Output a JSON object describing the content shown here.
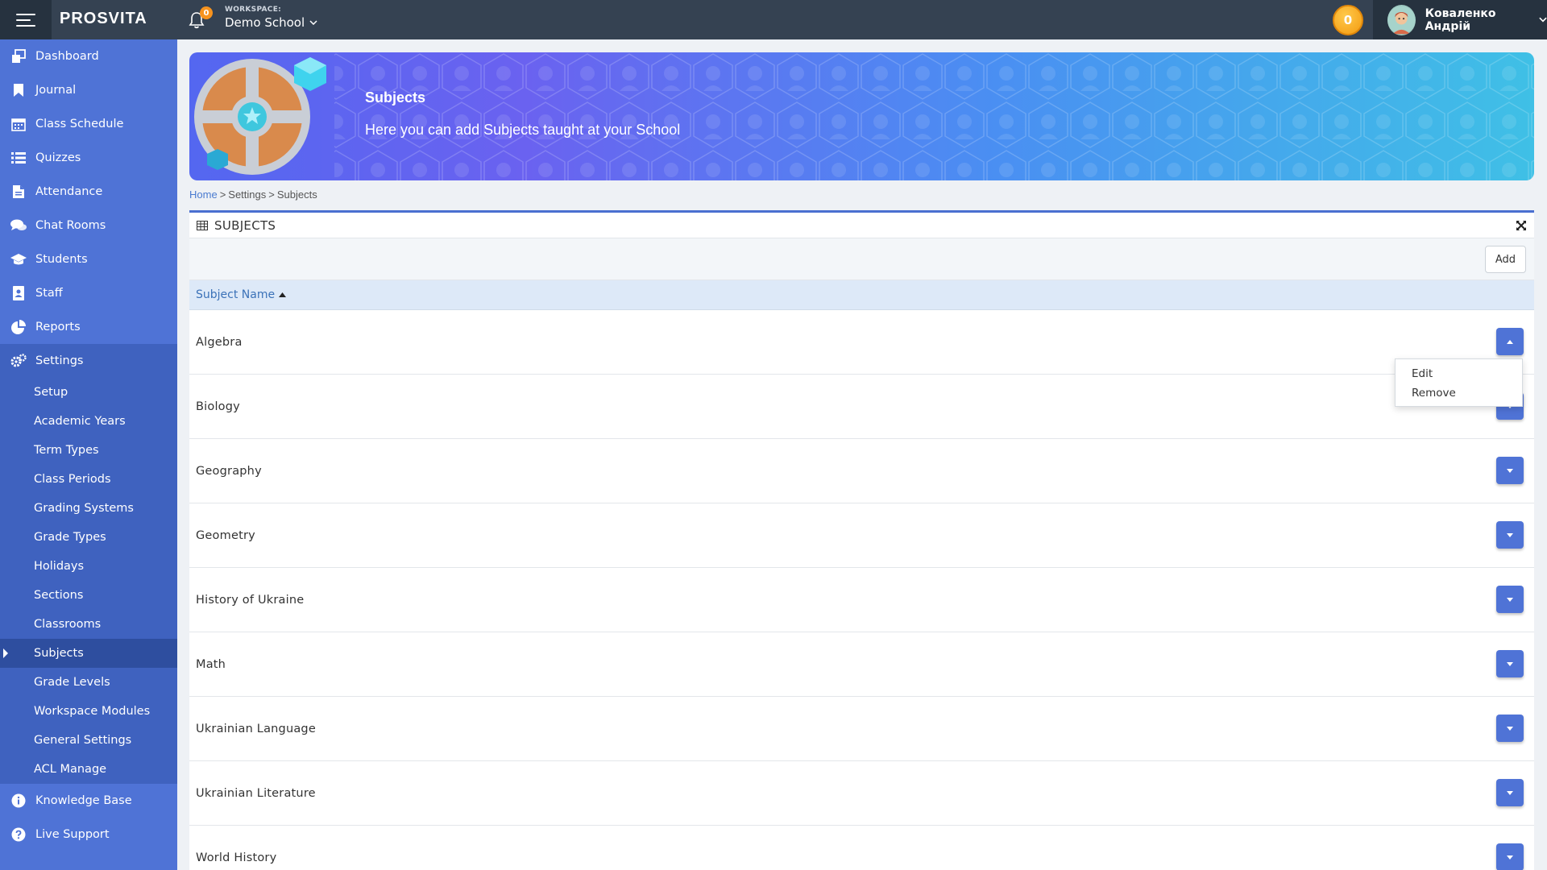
{
  "header": {
    "brand": "PROSVITA",
    "notifications_count": "0",
    "workspace_label": "WORKSPACE:",
    "workspace_name": "Demo School",
    "coins": "0",
    "user_name": "Коваленко Андрій"
  },
  "sidebar": {
    "items": [
      {
        "label": "Dashboard",
        "icon": "dashboard-icon"
      },
      {
        "label": "Journal",
        "icon": "bookmark-icon"
      },
      {
        "label": "Class Schedule",
        "icon": "calendar-icon"
      },
      {
        "label": "Quizzes",
        "icon": "list-icon"
      },
      {
        "label": "Attendance",
        "icon": "document-icon"
      },
      {
        "label": "Chat Rooms",
        "icon": "chat-icon"
      },
      {
        "label": "Students",
        "icon": "graduation-cap-icon"
      },
      {
        "label": "Staff",
        "icon": "staff-icon"
      },
      {
        "label": "Reports",
        "icon": "pie-chart-icon"
      }
    ],
    "settings": {
      "label": "Settings",
      "icon": "gears-icon",
      "subitems": [
        "Setup",
        "Academic Years",
        "Term Types",
        "Class Periods",
        "Grading Systems",
        "Grade Types",
        "Holidays",
        "Sections",
        "Classrooms",
        "Subjects",
        "Grade Levels",
        "Workspace Modules",
        "General Settings",
        "ACL Manage"
      ],
      "active": "Subjects"
    },
    "bottom_items": [
      {
        "label": "Knowledge Base",
        "icon": "info-icon"
      },
      {
        "label": "Live Support",
        "icon": "question-icon"
      }
    ]
  },
  "banner": {
    "title": "Subjects",
    "subtitle": "Here you can add Subjects taught at your School"
  },
  "breadcrumb": {
    "home": "Home",
    "sep": ">",
    "settings": "Settings",
    "current": "Subjects"
  },
  "panel": {
    "title": "SUBJECTS",
    "add_label": "Add",
    "column_header": "Subject Name",
    "rows": [
      "Algebra",
      "Biology",
      "Geography",
      "Geometry",
      "History of Ukraine",
      "Math",
      "Ukrainian Language",
      "Ukrainian Literature",
      "World History"
    ]
  },
  "dropdown": {
    "items": [
      "Edit",
      "Remove"
    ]
  },
  "colors": {
    "topbar": "#354252",
    "sidebar": "#4f73d6",
    "accent": "#4f73d6",
    "coin": "#f39a10"
  }
}
